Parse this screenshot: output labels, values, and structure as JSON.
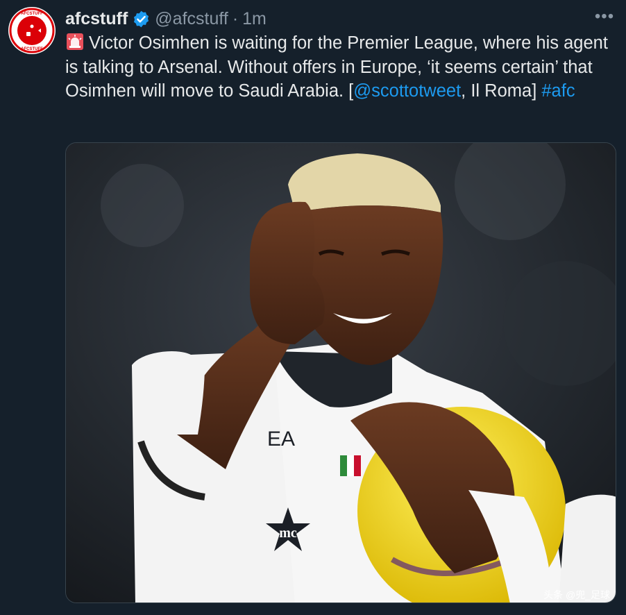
{
  "tweet": {
    "display_name": "afcstuff",
    "handle": "@afcstuff",
    "separator": "·",
    "time": "1m",
    "verified_icon": "verified-badge-icon",
    "more_label": "•••",
    "avatar": {
      "icon": "afcstuff-logo",
      "top_text": "AFCSTUFF",
      "bottom_text": "AFCSTUFF"
    },
    "emoji": "rotating-light-siren",
    "text_main": "Victor Osimhen is waiting for the Premier League, where his agent is talking to Arsenal. Without offers in Europe, ‘it seems certain’ that Osimhen will move to Saudi Arabia. [",
    "mention": "@scottotweet",
    "text_after_mention": ",",
    "text_source": " Il Roma] ",
    "hashtag": "#afc"
  },
  "media": {
    "description_icon": "player-thumbs-up-photo",
    "shirt_sponsor": "EA",
    "shirt_badge": "mc",
    "watermark": "头条 @兜_足球"
  },
  "colors": {
    "background": "#15202b",
    "text": "#e7e9ea",
    "secondary_text": "#8b98a5",
    "link": "#1d9bf0",
    "avatar_red": "#db0007"
  }
}
